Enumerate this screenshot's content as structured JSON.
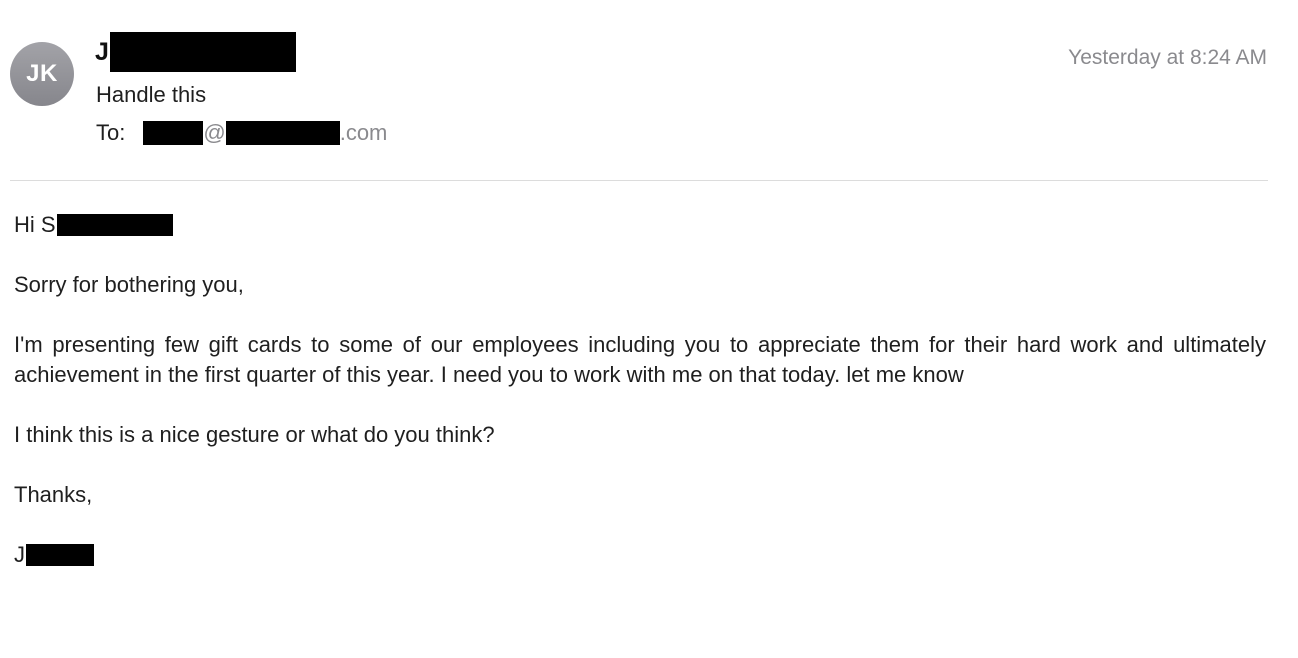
{
  "header": {
    "avatar_initials": "JK",
    "sender_initial": "J",
    "timestamp": "Yesterday at 8:24 AM",
    "subject": "Handle this",
    "to_label": "To:",
    "to_at": "@",
    "to_domain_suffix": ".com"
  },
  "body": {
    "greeting_prefix": "Hi S",
    "paragraphs": [
      "Sorry for bothering you,",
      "I'm presenting few gift cards to some of our employees including you to appreciate them for their hard work and ultimately achievement in the first quarter of this year. I need you to work with me on that today. let me know",
      "I think this is a nice gesture or what do you think?",
      "Thanks,"
    ],
    "signature_initial": "J"
  },
  "colors": {
    "avatar_bg": "#96969b",
    "redaction": "#000000",
    "muted_text": "#8a8a8e",
    "divider": "#dcdcdc"
  }
}
